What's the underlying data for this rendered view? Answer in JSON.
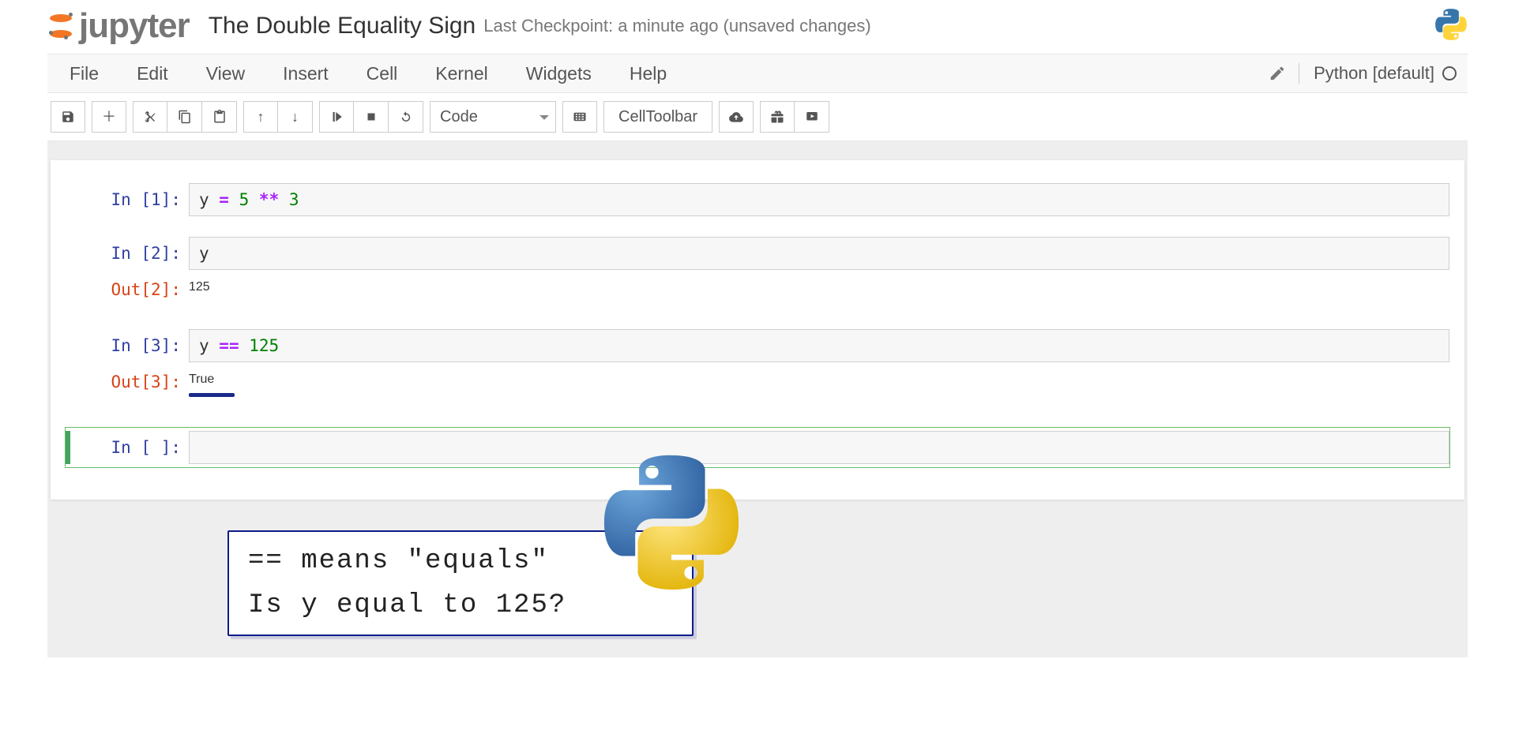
{
  "header": {
    "brand": "jupyter",
    "notebook_title": "The Double Equality Sign",
    "checkpoint": "Last Checkpoint: a minute ago (unsaved changes)"
  },
  "menubar": {
    "items": [
      "File",
      "Edit",
      "View",
      "Insert",
      "Cell",
      "Kernel",
      "Widgets",
      "Help"
    ],
    "kernel_name": "Python [default]"
  },
  "toolbar": {
    "cell_type_selected": "Code",
    "celltoolbar_label": "CellToolbar"
  },
  "cells": [
    {
      "in_prompt": "In [1]:",
      "code_tokens": [
        {
          "t": "y ",
          "c": "plain"
        },
        {
          "t": "=",
          "c": "op"
        },
        {
          "t": " ",
          "c": "plain"
        },
        {
          "t": "5",
          "c": "num"
        },
        {
          "t": " ",
          "c": "plain"
        },
        {
          "t": "**",
          "c": "op"
        },
        {
          "t": " ",
          "c": "plain"
        },
        {
          "t": "3",
          "c": "num"
        }
      ]
    },
    {
      "in_prompt": "In [2]:",
      "code_tokens": [
        {
          "t": "y",
          "c": "plain"
        }
      ],
      "out_prompt": "Out[2]:",
      "out_text": "125"
    },
    {
      "in_prompt": "In [3]:",
      "code_tokens": [
        {
          "t": "y ",
          "c": "plain"
        },
        {
          "t": "==",
          "c": "op"
        },
        {
          "t": " ",
          "c": "plain"
        },
        {
          "t": "125",
          "c": "num"
        }
      ],
      "out_prompt": "Out[3]:",
      "out_text": "True",
      "out_underline": true
    },
    {
      "in_prompt": "In [ ]:",
      "code_tokens": [],
      "selected": true
    }
  ],
  "annotation": {
    "line1": "== means \"equals\"",
    "line2": "Is y equal to 125?"
  }
}
